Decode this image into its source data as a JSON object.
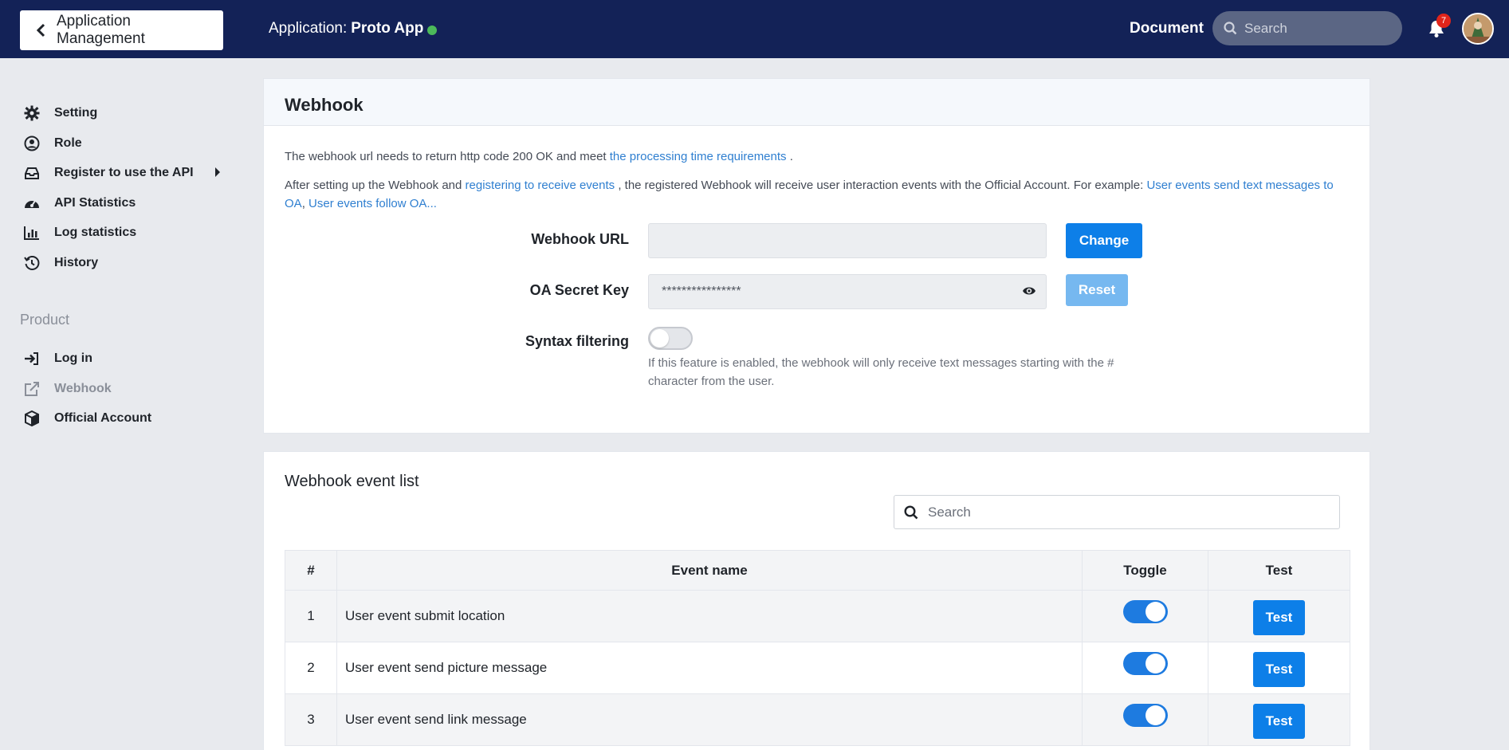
{
  "header": {
    "back_label": "Application Management",
    "app_prefix": "Application:",
    "app_name": "Proto App",
    "status_color": "#4cba5a",
    "document_label": "Document",
    "search_placeholder": "Search",
    "notification_count": "7"
  },
  "sidebar": {
    "items": [
      {
        "label": "Setting",
        "icon": "gear-icon"
      },
      {
        "label": "Role",
        "icon": "user-circle-icon"
      },
      {
        "label": "Register to use the API",
        "icon": "inbox-icon"
      },
      {
        "label": "API Statistics",
        "icon": "dashboard-icon"
      },
      {
        "label": "Log statistics",
        "icon": "bar-chart-icon"
      },
      {
        "label": "History",
        "icon": "history-icon"
      }
    ],
    "section_label": "Product",
    "product_items": [
      {
        "label": "Log in",
        "icon": "sign-in-icon"
      },
      {
        "label": "Webhook",
        "icon": "external-link-icon"
      },
      {
        "label": "Official Account",
        "icon": "cube-icon"
      }
    ]
  },
  "webhook": {
    "title": "Webhook",
    "p1_text": "The webhook url needs to return http code 200 OK and meet",
    "p1_link": "the processing time requirements",
    "p1_end": ".",
    "p2_text1": "After setting up the Webhook and",
    "p2_link1": "registering to receive events",
    "p2_text2": ", the registered Webhook will receive user interaction events with the Official Account. For example:",
    "p2_link2": "User events send text messages to OA",
    "p2_sep": ",",
    "p2_link3": "User events follow OA...",
    "url_label": "Webhook URL",
    "url_value": "",
    "change_label": "Change",
    "secret_label": "OA Secret Key",
    "secret_value": "****************",
    "reset_label": "Reset",
    "syntax_label": "Syntax filtering",
    "syntax_enabled": false,
    "syntax_hint": "If this feature is enabled, the webhook will only receive text messages starting with the # character from the user."
  },
  "events": {
    "title": "Webhook event list",
    "search_placeholder": "Search",
    "columns": [
      "#",
      "Event name",
      "Toggle",
      "Test"
    ],
    "rows": [
      {
        "num": "1",
        "name": "User event submit location",
        "enabled": true,
        "test_label": "Test"
      },
      {
        "num": "2",
        "name": "User event send picture message",
        "enabled": true,
        "test_label": "Test"
      },
      {
        "num": "3",
        "name": "User event send link message",
        "enabled": true,
        "test_label": "Test"
      }
    ]
  }
}
